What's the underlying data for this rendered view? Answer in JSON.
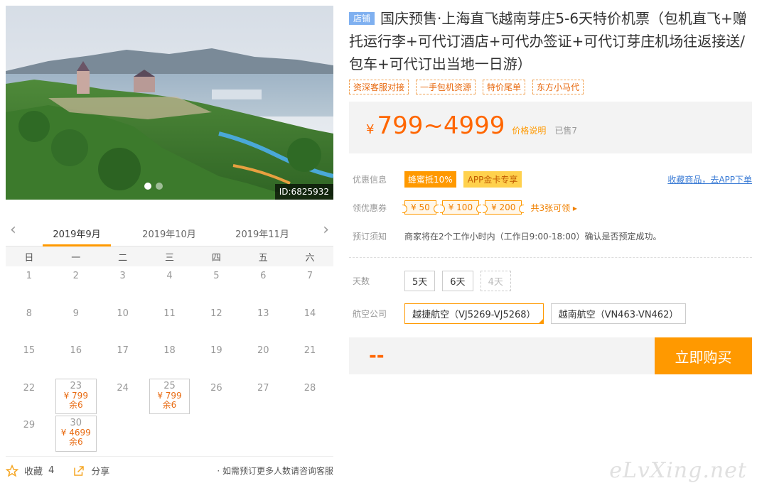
{
  "product": {
    "shop_tag": "店铺",
    "title": "国庆预售·上海直飞越南芽庄5-6天特价机票（包机直飞+赠托运行李+可代订酒店+可代办签证+可代订芽庄机场往返接送/包车+可代订出当地一日游）",
    "tags": [
      "资深客服对接",
      "一手包机资源",
      "特价尾单",
      "东方小马代"
    ],
    "photo_id": "ID:6825932"
  },
  "price": {
    "currency": "¥",
    "range": "799~4999",
    "note": "价格说明",
    "sold": "已售7"
  },
  "discount": {
    "label": "优惠信息",
    "badge_a": "蜂蜜抵10%",
    "badge_b": "APP金卡专享",
    "app_link": "收藏商品，去APP下单"
  },
  "coupons": {
    "label": "领优惠券",
    "items": [
      "¥ 50",
      "¥ 100",
      "¥ 200"
    ],
    "more": "共3张可领 ▸"
  },
  "notice": {
    "label": "预订须知",
    "text": "商家将在2个工作小时内（工作日9:00-18:00）确认是否预定成功。"
  },
  "days": {
    "label": "天数",
    "options": [
      "5天",
      "6天",
      "4天"
    ]
  },
  "airline": {
    "label": "航空公司",
    "options": [
      "越捷航空（VJ5269-VJ5268）",
      "越南航空（VN463-VN462）"
    ]
  },
  "buy": {
    "total": "--",
    "button": "立即购买"
  },
  "calendar": {
    "prev": "‹",
    "next": "›",
    "months": [
      "2019年9月",
      "2019年10月",
      "2019年11月"
    ],
    "weekdays": [
      "日",
      "一",
      "二",
      "三",
      "四",
      "五",
      "六"
    ],
    "days": [
      {
        "d": "1"
      },
      {
        "d": "2"
      },
      {
        "d": "3"
      },
      {
        "d": "4"
      },
      {
        "d": "5"
      },
      {
        "d": "6"
      },
      {
        "d": "7"
      },
      {
        "d": "8"
      },
      {
        "d": "9"
      },
      {
        "d": "10"
      },
      {
        "d": "11"
      },
      {
        "d": "12"
      },
      {
        "d": "13"
      },
      {
        "d": "14"
      },
      {
        "d": "15"
      },
      {
        "d": "16"
      },
      {
        "d": "17"
      },
      {
        "d": "18"
      },
      {
        "d": "19"
      },
      {
        "d": "20"
      },
      {
        "d": "21"
      },
      {
        "d": "22"
      },
      {
        "d": "23",
        "p": "¥ 799",
        "s": "余6"
      },
      {
        "d": "24"
      },
      {
        "d": "25",
        "p": "¥ 799",
        "s": "余6"
      },
      {
        "d": "26"
      },
      {
        "d": "27"
      },
      {
        "d": "28"
      },
      {
        "d": "29"
      },
      {
        "d": "30",
        "p": "¥ 4699",
        "s": "余6"
      }
    ]
  },
  "footer": {
    "fav_label": "收藏",
    "fav_count": "4",
    "share_label": "分享",
    "note": "· 如需预订更多人数请咨询客服"
  },
  "watermark": "eLvXing.net",
  "colors": {
    "accent": "#ff9900",
    "price": "#ff6600",
    "link": "#3a7bd5"
  }
}
